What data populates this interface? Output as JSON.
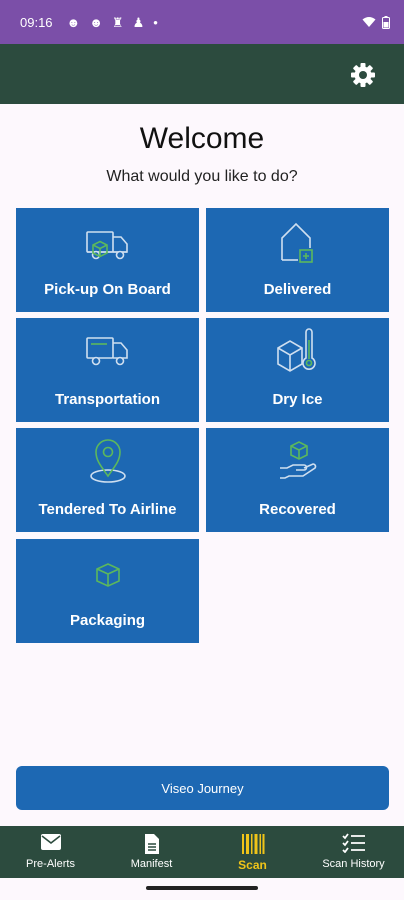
{
  "status_bar": {
    "time": "09:16",
    "notification_icons": [
      "face-icon",
      "face-icon",
      "bag-icon",
      "person-icon",
      "dot-icon"
    ],
    "system_icons": [
      "wifi-icon",
      "battery-icon"
    ]
  },
  "app_bar": {
    "settings_icon": "gear-icon"
  },
  "header": {
    "title": "Welcome",
    "subtitle": "What would you like to do?"
  },
  "tiles": [
    {
      "label": "Pick-up On Board",
      "icon": "truck-with-box-icon"
    },
    {
      "label": "Delivered",
      "icon": "house-with-plus-icon"
    },
    {
      "label": "Transportation",
      "icon": "truck-icon"
    },
    {
      "label": "Dry Ice",
      "icon": "box-with-thermometer-icon"
    },
    {
      "label": "Tendered To Airline",
      "icon": "location-pin-icon"
    },
    {
      "label": "Recovered",
      "icon": "hand-holding-box-icon"
    },
    {
      "label": "Packaging",
      "icon": "box-icon"
    }
  ],
  "journey_button": {
    "label": "Viseo Journey"
  },
  "bottom_nav": {
    "active": "Scan",
    "items": [
      {
        "label": "Pre-Alerts",
        "icon": "envelope-icon"
      },
      {
        "label": "Manifest",
        "icon": "document-icon"
      },
      {
        "label": "Scan",
        "icon": "barcode-icon"
      },
      {
        "label": "Scan History",
        "icon": "checklist-icon"
      }
    ]
  },
  "colors": {
    "status_bar": "#7b4fa8",
    "app_bar": "#2c4b3e",
    "tile": "#1d68b3",
    "icon_outline": "#cfdff0",
    "icon_accent": "#5cb85c",
    "active_nav": "#f0c419",
    "background": "#fdf8fd"
  }
}
